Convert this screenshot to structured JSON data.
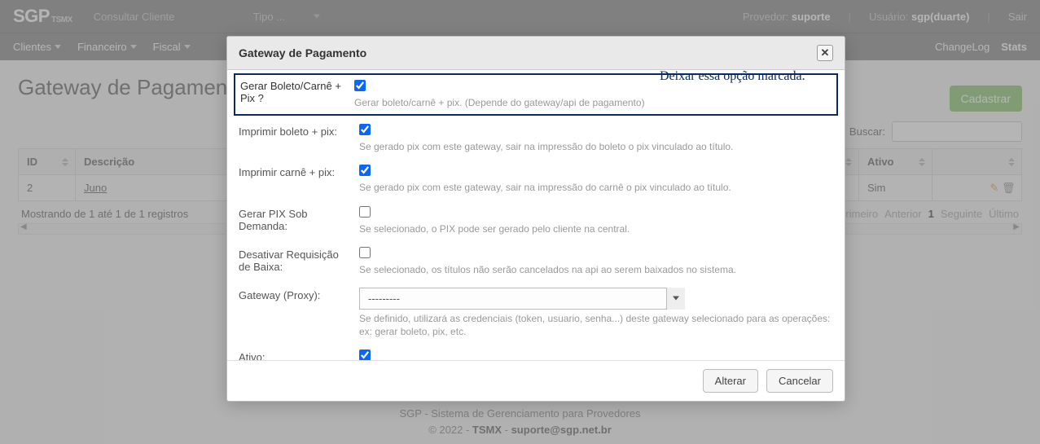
{
  "topbar": {
    "logo_main": "SGP",
    "logo_sub": "TSMX",
    "search_placeholder": "Consultar Cliente",
    "type_label": "Tipo ...",
    "provider_label": "Provedor:",
    "provider_value": "suporte",
    "user_label": "Usuário:",
    "user_value": "sgp(duarte)",
    "logout": "Sair"
  },
  "nav": {
    "items": [
      "Clientes",
      "Financeiro",
      "Fiscal"
    ],
    "changelog": "ChangeLog",
    "stats": "Stats"
  },
  "page": {
    "title": "Gateway de Pagamento",
    "cadastrar": "Cadastrar",
    "search_label": "Buscar:",
    "columns": {
      "id": "ID",
      "descricao": "Descrição",
      "ativo": "Ativo"
    },
    "rows": [
      {
        "id": "2",
        "descricao": "Juno",
        "ativo": "Sim"
      }
    ],
    "info": "Mostrando de 1 até 1 de 1 registros",
    "pager": {
      "first": "Primeiro",
      "prev": "Anterior",
      "page": "1",
      "next": "Seguinte",
      "last": "Último"
    }
  },
  "modal": {
    "title": "Gateway de Pagamento",
    "annotation": "Deixar essa opção marcada.",
    "fields": {
      "gerar_boleto_pix": {
        "label": "Gerar Boleto/Carnê + Pix ?",
        "help": "Gerar boleto/carnê + pix. (Depende do gateway/api de pagamento)",
        "checked": true
      },
      "imprimir_boleto_pix": {
        "label": "Imprimir boleto + pix:",
        "help": "Se gerado pix com este gateway, sair na impressão do boleto o pix vinculado ao título.",
        "checked": true
      },
      "imprimir_carne_pix": {
        "label": "Imprimir carnê + pix:",
        "help": "Se gerado pix com este gateway, sair na impressão do carnê o pix vinculado ao título.",
        "checked": true
      },
      "pix_demanda": {
        "label": "Gerar PIX Sob Demanda:",
        "help": "Se selecionado, o PIX pode ser gerado pelo cliente na central.",
        "checked": false
      },
      "desativar_baixa": {
        "label": "Desativar Requisição de Baixa:",
        "help": "Se selecionado, os títulos não serão cancelados na api ao serem baixados no sistema.",
        "checked": false
      },
      "gateway_proxy": {
        "label": "Gateway (Proxy):",
        "value": "---------",
        "help": "Se definido, utilizará as credenciais (token, usuario, senha...) deste gateway selecionado para as operações: ex: gerar boleto, pix, etc."
      },
      "ativo": {
        "label": "Ativo:",
        "checked": true
      }
    },
    "buttons": {
      "alterar": "Alterar",
      "cancelar": "Cancelar"
    }
  },
  "footer": {
    "line1": "SGP - Sistema de Gerenciamento para Provedores",
    "line2_pre": "© 2022 - ",
    "line2_bold": "TSMX",
    "line2_sep": " - ",
    "email": "suporte@sgp.net.br"
  },
  "iconchars": {
    "close": "✕"
  }
}
